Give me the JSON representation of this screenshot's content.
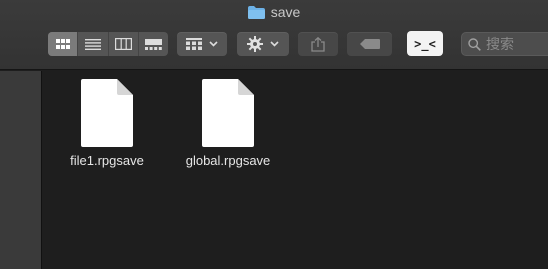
{
  "window": {
    "title": "save"
  },
  "toolbar": {
    "view_modes": [
      "icon-view",
      "list-view",
      "column-view",
      "gallery-view"
    ],
    "active_view": "icon-view",
    "search_placeholder": "搜索",
    "terminal_glyph": ">_<"
  },
  "files": [
    {
      "name": "file1.rpgsave",
      "icon": "document-icon"
    },
    {
      "name": "global.rpgsave",
      "icon": "document-icon"
    }
  ],
  "colors": {
    "folder_blue": "#6cb1e6",
    "toolbar_bg": "#3b3b3b",
    "content_bg": "#1e1e1e"
  }
}
